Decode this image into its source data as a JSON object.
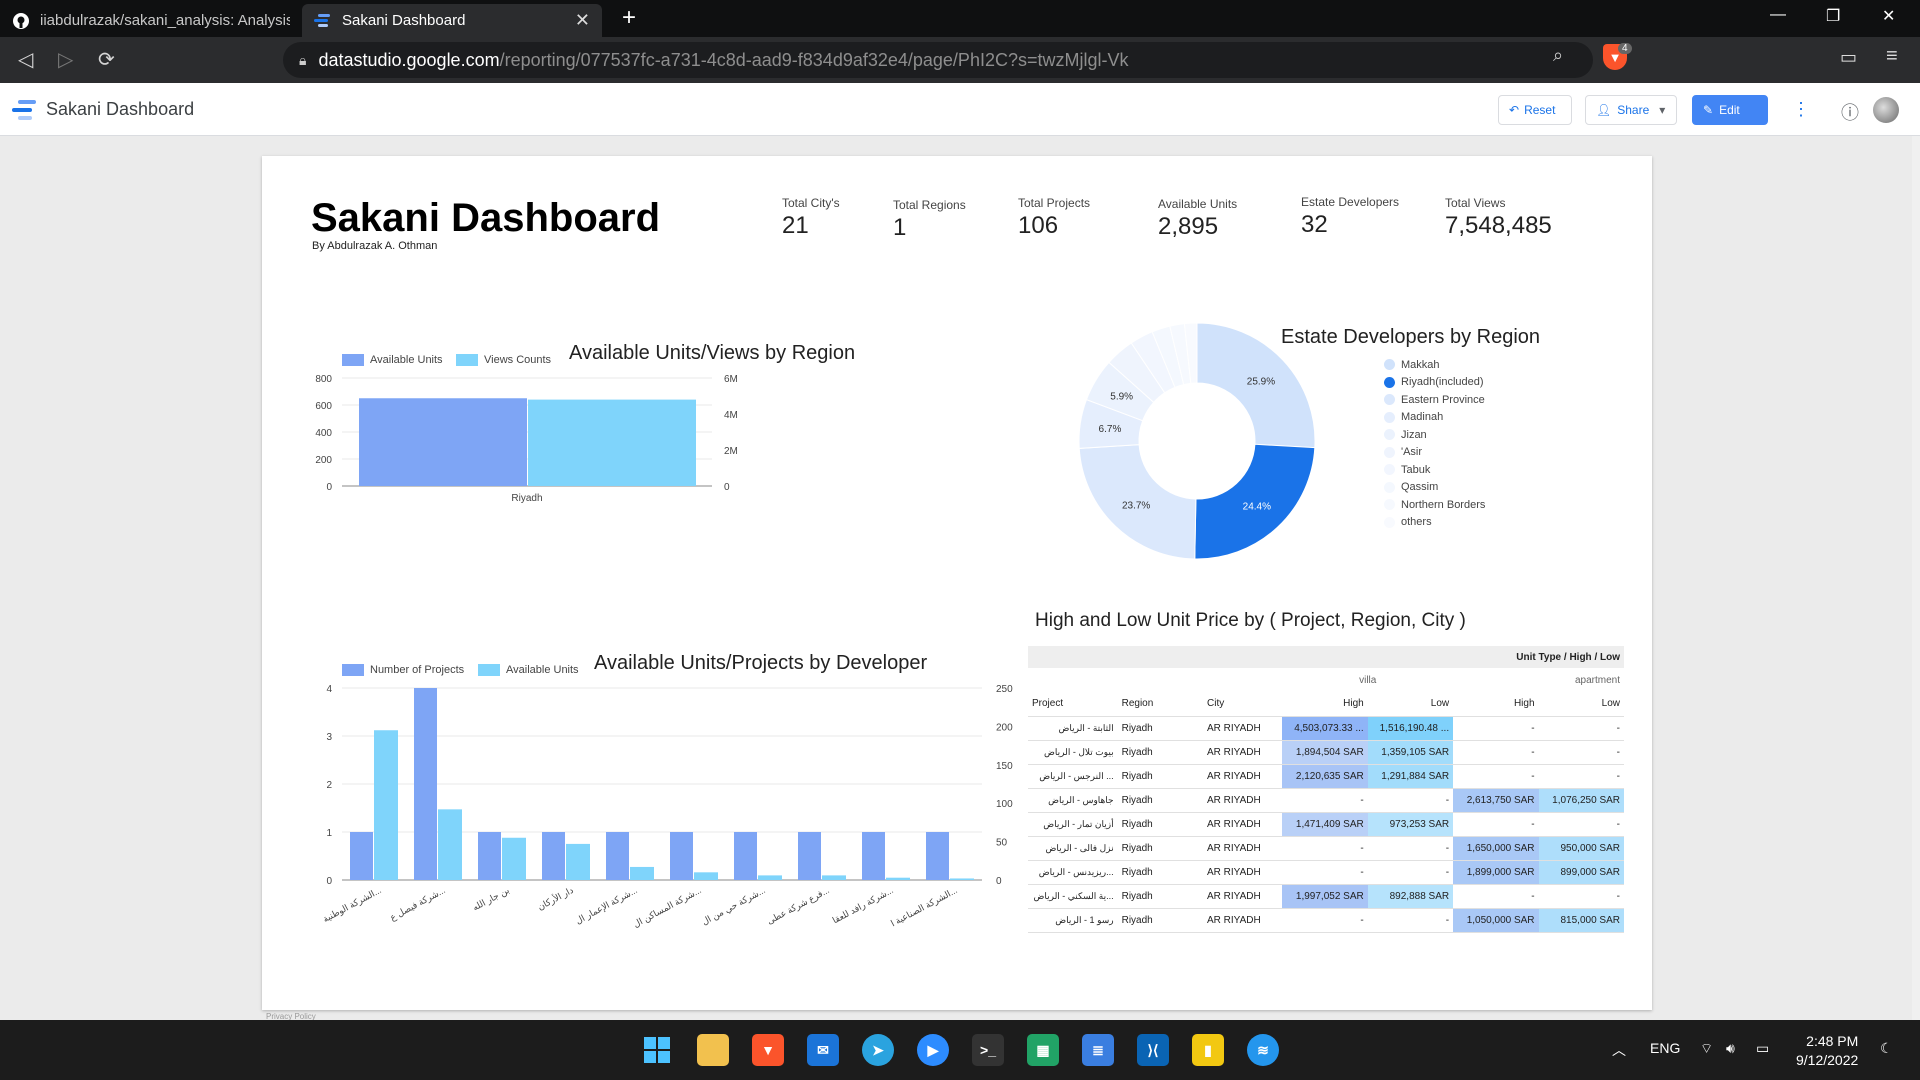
{
  "browser": {
    "tabs": [
      {
        "title": "iiabdulrazak/sakani_analysis: Analysis",
        "active": false
      },
      {
        "title": "Sakani Dashboard",
        "active": true
      }
    ],
    "url_host": "datastudio.google.com",
    "url_path": "/reporting/077537fc-a731-4c8d-aad9-f834d9af32e4/page/PhI2C?s=twzMjlgl-Vk",
    "brave_badge": "4"
  },
  "app": {
    "title": "Sakani Dashboard",
    "reset_label": "Reset",
    "share_label": "Share",
    "edit_label": "Edit"
  },
  "report": {
    "title": "Sakani Dashboard",
    "byline": "By Abdulrazak A. Othman",
    "kpis": [
      {
        "label": "Total City's",
        "value": "21"
      },
      {
        "label": "Total Regions",
        "value": "1"
      },
      {
        "label": "Total Projects",
        "value": "106"
      },
      {
        "label": "Available Units",
        "value": "2,895"
      },
      {
        "label": "Estate Developers",
        "value": "32"
      },
      {
        "label": "Total Views",
        "value": "7,548,485"
      }
    ],
    "privacy": "Privacy Policy"
  },
  "chart_data": [
    {
      "type": "bar",
      "title": "Available Units/Views by Region",
      "categories": [
        "Riyadh"
      ],
      "series": [
        {
          "name": "Available Units",
          "values": [
            650
          ],
          "axis": "left",
          "color": "#7ea5f5"
        },
        {
          "name": "Views Counts",
          "values": [
            4800000
          ],
          "axis": "right",
          "color": "#7fd4fb"
        }
      ],
      "yleft_ticks": [
        "0",
        "200",
        "400",
        "600",
        "800"
      ],
      "yleft_lim": [
        0,
        800
      ],
      "yright_ticks": [
        "0",
        "2M",
        "4M",
        "6M"
      ],
      "yright_lim": [
        0,
        6000000
      ]
    },
    {
      "type": "pie",
      "title": "Estate Developers by Region",
      "slices": [
        {
          "label": "Makkah",
          "value": 25.9,
          "color": "#d0e2fb"
        },
        {
          "label": "Riyadh(included)",
          "value": 24.4,
          "color": "#1a73e8"
        },
        {
          "label": "Eastern Province",
          "value": 23.7,
          "color": "#dbe8fc"
        },
        {
          "label": "Madinah",
          "value": 6.7,
          "color": "#e5eefd"
        },
        {
          "label": "Jizan",
          "value": 5.9,
          "color": "#ebf2fd"
        },
        {
          "label": "'Asir",
          "value": 4.0,
          "color": "#eff4fd"
        },
        {
          "label": "Tabuk",
          "value": 3.2,
          "color": "#f2f6fe"
        },
        {
          "label": "Qassim",
          "value": 2.5,
          "color": "#f4f8fe"
        },
        {
          "label": "Northern Borders",
          "value": 2.0,
          "color": "#f6f9fe"
        },
        {
          "label": "others",
          "value": 1.7,
          "color": "#f8fafe"
        }
      ],
      "shown_labels": [
        "25.9%",
        "24.4%",
        "23.7%",
        "6.7%",
        "5.9%"
      ]
    },
    {
      "type": "bar",
      "title": "Available Units/Projects by Developer",
      "categories": [
        "الشركة الوطنية...",
        "شركة فيصل ع...",
        "بن جار الله",
        "دار الأركان",
        "شركة الإعمار ال...",
        "شركة المساكن ال...",
        "شركة حي من ال...",
        "فرع شركة عطى...",
        "شركة رافد للعقا...",
        "الشركة الصناعية ا..."
      ],
      "series": [
        {
          "name": "Number of Projects",
          "values": [
            1,
            4,
            1,
            1,
            1,
            1,
            1,
            1,
            1,
            1
          ],
          "axis": "left",
          "color": "#7ea5f5"
        },
        {
          "name": "Available Units",
          "values": [
            195,
            92,
            55,
            47,
            17,
            10,
            6,
            6,
            3,
            2
          ],
          "axis": "right",
          "color": "#7fd4fb"
        }
      ],
      "yleft_ticks": [
        "0",
        "1",
        "2",
        "3",
        "4"
      ],
      "yleft_lim": [
        0,
        4
      ],
      "yright_ticks": [
        "0",
        "50",
        "100",
        "150",
        "200",
        "250"
      ],
      "yright_lim": [
        0,
        250
      ]
    }
  ],
  "price_table": {
    "title": "High and Low Unit Price by ( Project, Region, City )",
    "group_header": "Unit Type / High / Low",
    "unit_types": [
      "villa",
      "apartment"
    ],
    "columns": [
      "Project",
      "Region",
      "City",
      "High",
      "Low",
      "High",
      "Low"
    ],
    "rows": [
      [
        "الثابتة - الرياض",
        "Riyadh",
        "AR RIYADH",
        "4,503,073.33 ...",
        "1,516,190.48 ...",
        "-",
        "-"
      ],
      [
        "بيوت تلال - الرياض",
        "Riyadh",
        "AR RIYADH",
        "1,894,504 SAR",
        "1,359,105 SAR",
        "-",
        "-"
      ],
      [
        "... النرجس - الرياض",
        "Riyadh",
        "AR RIYADH",
        "2,120,635 SAR",
        "1,291,884 SAR",
        "-",
        "-"
      ],
      [
        "جاهاوس - الرياض",
        "Riyadh",
        "AR RIYADH",
        "-",
        "-",
        "2,613,750 SAR",
        "1,076,250 SAR"
      ],
      [
        "أزيان تمار - الرياض",
        "Riyadh",
        "AR RIYADH",
        "1,471,409 SAR",
        "973,253 SAR",
        "-",
        "-"
      ],
      [
        "نزل فالى - الرياض",
        "Riyadh",
        "AR RIYADH",
        "-",
        "-",
        "1,650,000 SAR",
        "950,000 SAR"
      ],
      [
        "...ريزيدنس - الرياض",
        "Riyadh",
        "AR RIYADH",
        "-",
        "-",
        "1,899,000 SAR",
        "899,000 SAR"
      ],
      [
        "...ية السكني - الرياض",
        "Riyadh",
        "AR RIYADH",
        "1,997,052 SAR",
        "892,888 SAR",
        "-",
        "-"
      ],
      [
        "رسو 1 - الرياض",
        "Riyadh",
        "AR RIYADH",
        "-",
        "-",
        "1,050,000 SAR",
        "815,000 SAR"
      ]
    ]
  },
  "taskbar": {
    "lang": "ENG",
    "time": "2:48 PM",
    "date": "9/12/2022"
  }
}
